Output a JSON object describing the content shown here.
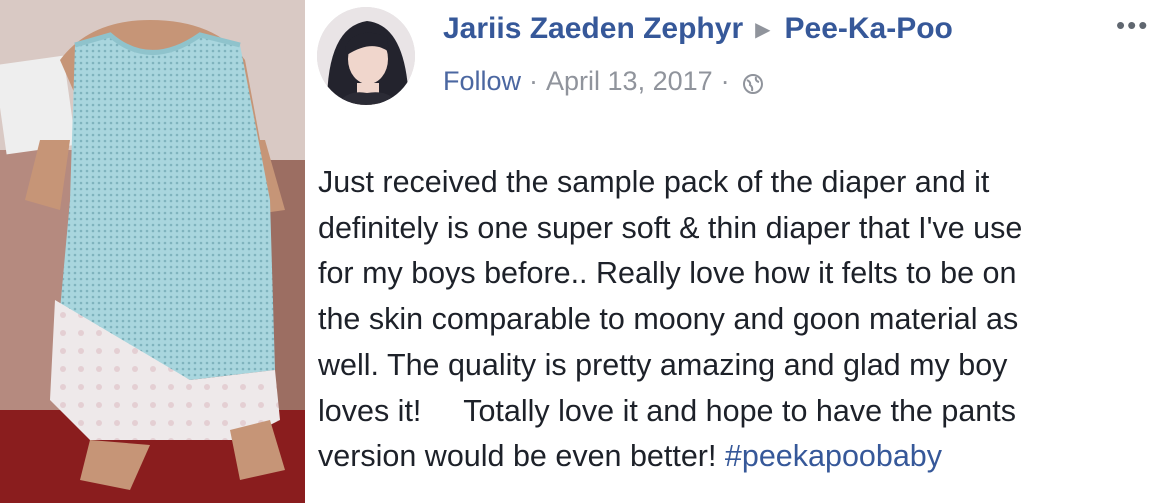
{
  "post": {
    "author": "Jariis Zaeden Zephyr",
    "arrow": "▶",
    "page_name": "Pee-Ka-Poo",
    "more": "•••",
    "follow": "Follow",
    "sep1": "·",
    "date": "April 13, 2017",
    "sep2": "·",
    "body_lines": [
      "Just received the sample pack of the diaper and it",
      "definitely is one super soft & thin diaper that I've use",
      "for my boys before.. Really love how it felts to be on",
      "the skin comparable to moony and goon material as",
      "well. The quality is pretty amazing and glad my boy",
      "loves it!     Totally love it and hope to have the pants",
      "version would be even better! "
    ],
    "hashtag": "#peekapoobaby"
  },
  "icons": {
    "globe": "globe-icon",
    "more": "more-options-icon"
  },
  "colors": {
    "link": "#365899",
    "meta": "#90949c",
    "text": "#1d2129"
  }
}
